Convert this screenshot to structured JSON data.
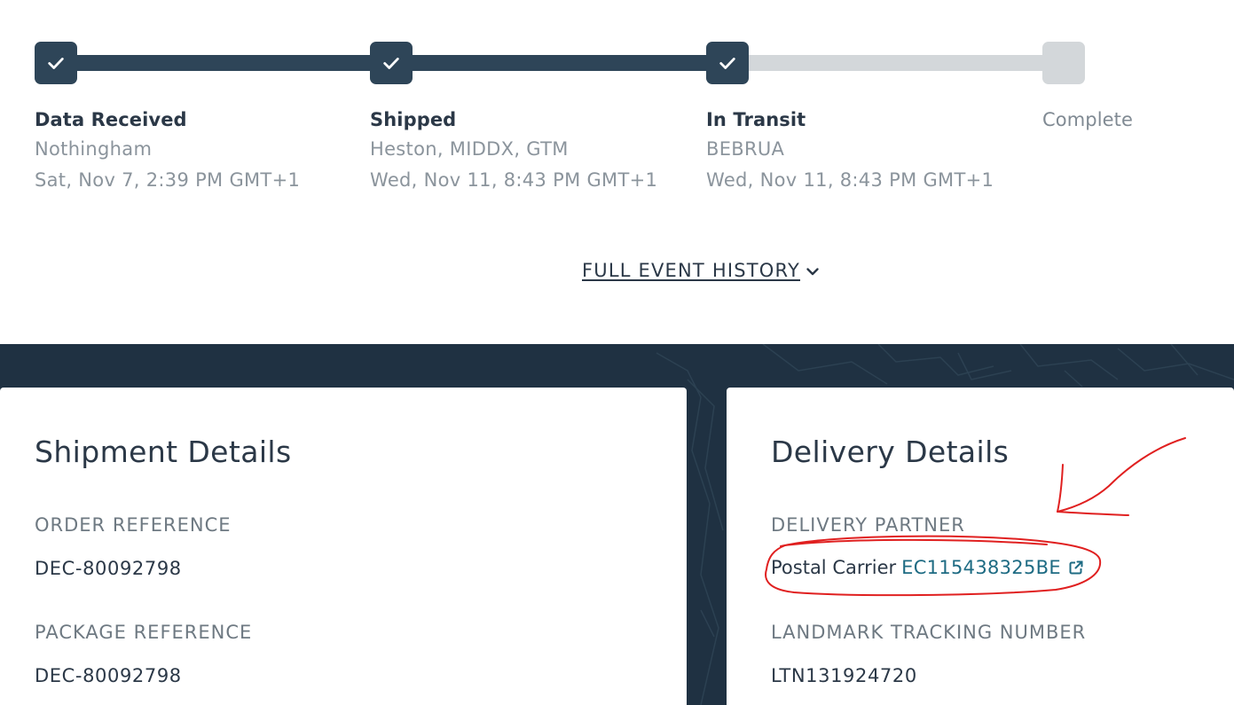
{
  "tracker": {
    "steps": [
      {
        "title": "Data Received",
        "location": "Nothingham",
        "datetime": "Sat, Nov 7, 2:39 PM GMT+1",
        "status": "done"
      },
      {
        "title": "Shipped",
        "location": "Heston, MIDDX, GTM",
        "datetime": "Wed, Nov 11, 8:43 PM GMT+1",
        "status": "done"
      },
      {
        "title": "In Transit",
        "location": "BEBRUA",
        "datetime": "Wed, Nov 11, 8:43 PM GMT+1",
        "status": "done"
      },
      {
        "title": "Complete",
        "status": "pending"
      }
    ],
    "history_link": "FULL EVENT HISTORY"
  },
  "shipment": {
    "title": "Shipment Details",
    "order_reference_label": "ORDER REFERENCE",
    "order_reference": "DEC-80092798",
    "package_reference_label": "PACKAGE REFERENCE",
    "package_reference": "DEC-80092798"
  },
  "delivery": {
    "title": "Delivery Details",
    "partner_label": "DELIVERY PARTNER",
    "partner_name": "Postal Carrier",
    "partner_tracking": "EC115438325BE",
    "tracking_number_label": "LANDMARK TRACKING NUMBER",
    "tracking_number": "LTN131924720"
  },
  "colors": {
    "step_done": "#2e4558",
    "step_todo": "#d3d7da",
    "band": "#1f3142",
    "link": "#1e6b83",
    "annotation": "#e02020"
  },
  "icons": [
    "check-icon",
    "chevron-down-icon",
    "external-link-icon"
  ]
}
